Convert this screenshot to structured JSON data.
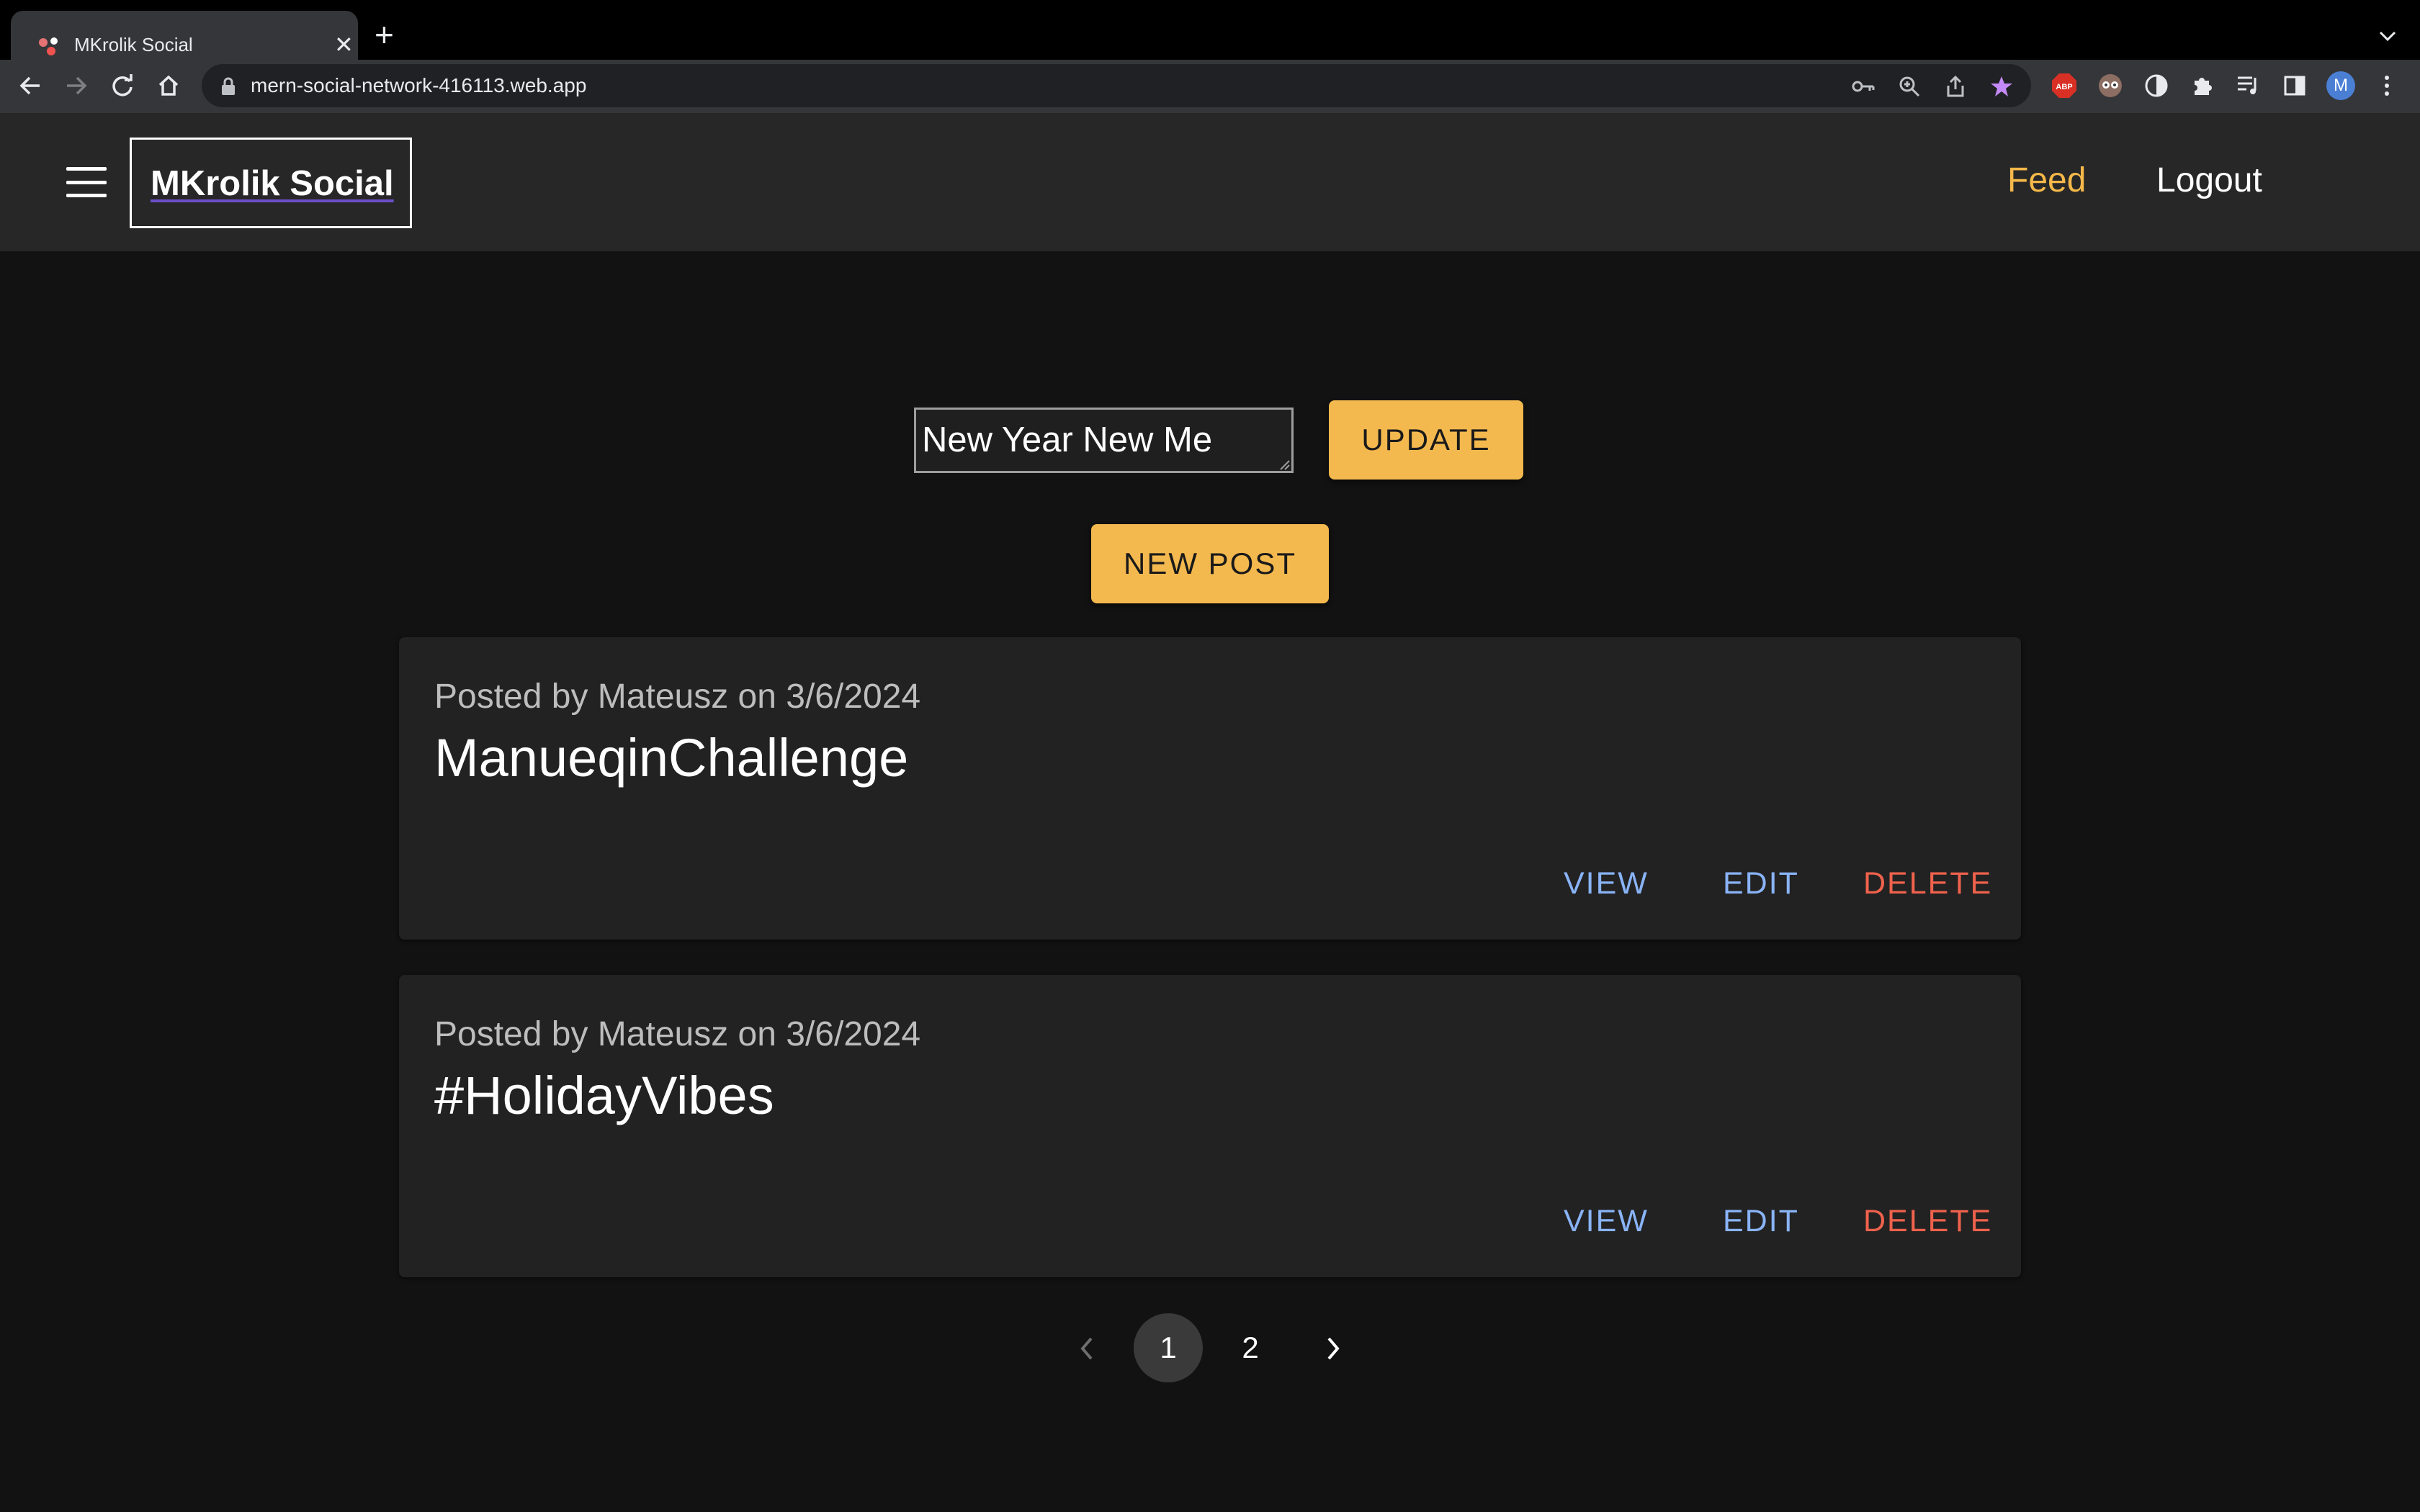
{
  "browser": {
    "tab_title": "MKrolik Social",
    "url": "mern-social-network-416113.web.app",
    "profile_initial": "M",
    "extension_abp_label": "ABP"
  },
  "header": {
    "brand": "MKrolik Social",
    "nav": {
      "feed": "Feed",
      "logout": "Logout"
    },
    "active_color": "#f5b94a"
  },
  "editor": {
    "title_value": "New Year New Me",
    "update_label": "UPDATE",
    "new_post_label": "NEW POST"
  },
  "posts": [
    {
      "meta": "Posted by Mateusz on 3/6/2024",
      "title": "ManueqinChallenge",
      "view_label": "VIEW",
      "edit_label": "EDIT",
      "delete_label": "DELETE"
    },
    {
      "meta": "Posted by Mateusz on 3/6/2024",
      "title": "#HolidayVibes",
      "view_label": "VIEW",
      "edit_label": "EDIT",
      "delete_label": "DELETE"
    }
  ],
  "pagination": {
    "pages": [
      "1",
      "2"
    ],
    "current": "1"
  }
}
